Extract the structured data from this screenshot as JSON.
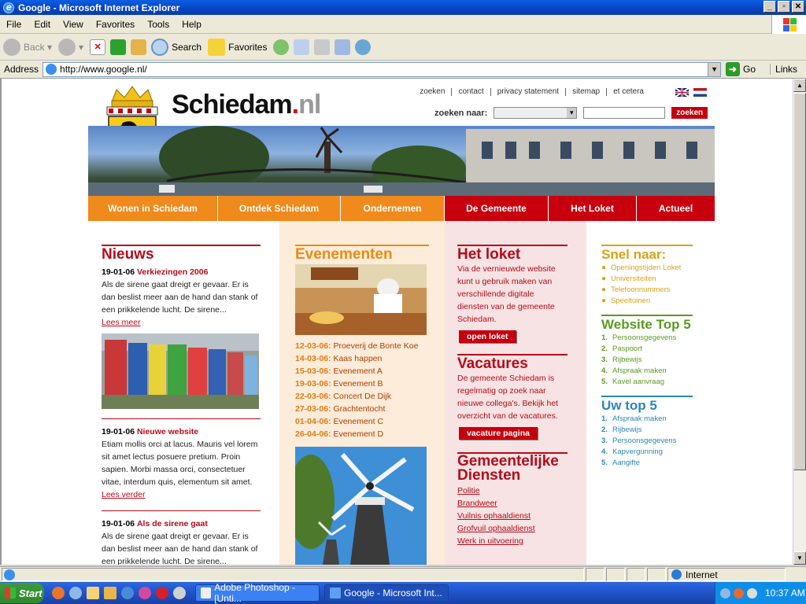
{
  "window": {
    "title": "Google - Microsoft Internet Explorer"
  },
  "menu": [
    "File",
    "Edit",
    "View",
    "Favorites",
    "Tools",
    "Help"
  ],
  "toolbar": {
    "back": "Back",
    "search": "Search",
    "favorites": "Favorites"
  },
  "address": {
    "label": "Address",
    "url": "http://www.google.nl/",
    "go": "Go",
    "links": "Links"
  },
  "site": {
    "brand": {
      "name": "Schiedam",
      "dot": ".",
      "tld": "nl"
    },
    "toplinks": [
      "zoeken",
      "contact",
      "privacy statement",
      "sitemap",
      "et cetera"
    ],
    "search": {
      "label": "zoeken naar:",
      "button": "zoeken"
    },
    "nav": [
      {
        "label": "Wonen in Schiedam",
        "color": "#f08a1c"
      },
      {
        "label": "Ontdek Schiedam",
        "color": "#f08a1c"
      },
      {
        "label": "Ondernemen",
        "color": "#f08a1c"
      },
      {
        "label": "De Gemeente",
        "color": "#c8000e"
      },
      {
        "label": "Het Loket",
        "color": "#c8000e"
      },
      {
        "label": "Actueel",
        "color": "#c8000e"
      }
    ],
    "news": {
      "title": "Nieuws",
      "items": [
        {
          "date": "19-01-06",
          "headline": "Verkiezingen 2006",
          "text": "Als de sirene gaat dreigt er gevaar. Er is dan beslist meer aan de hand dan stank of een prikkelende lucht. De sirene...",
          "more": "Lees meer"
        },
        {
          "date": "19-01-06",
          "headline": "Nieuwe website",
          "text": "Etiam mollis orci at lacus. Mauris vel lorem sit amet lectus posuere pretium. Proin sapien. Morbi massa orci, consectetuer vitae, interdum quis, elementum sit amet.",
          "more": "Lees verder"
        },
        {
          "date": "19-01-06",
          "headline": "Als de sirene gaat",
          "text": "Als de sirene gaat dreigt er gevaar. Er is dan beslist meer aan de hand dan stank of een prikkelende lucht. De sirene..."
        }
      ]
    },
    "events": {
      "title": "Evenementen",
      "items": [
        {
          "date": "12-03-06:",
          "name": "Proeverij de Bonte Koe"
        },
        {
          "date": "14-03-06:",
          "name": "Kaas happen"
        },
        {
          "date": "15-03-06:",
          "name": "Evenement A"
        },
        {
          "date": "19-03-06:",
          "name": "Evenement B"
        },
        {
          "date": "22-03-06:",
          "name": "Concert De Dijk"
        },
        {
          "date": "27-03-06:",
          "name": "Grachtentocht"
        },
        {
          "date": "01-04-06:",
          "name": "Evenement C"
        },
        {
          "date": "26-04-06:",
          "name": "Evenement D"
        }
      ]
    },
    "loket": {
      "title": "Het loket",
      "text": "Via de vernieuwde website kunt u gebruik maken van verschillende digitale diensten van de gemeente Schiedam.",
      "button": "open loket"
    },
    "vacatures": {
      "title": "Vacatures",
      "text": "De gemeente Schiedam is regelmatig op zoek naar nieuwe collega's. Bekijk het overzicht van de vacatures.",
      "button": "vacature pagina"
    },
    "diensten": {
      "title1": "Gemeentelijke",
      "title2": "Diensten",
      "links": [
        "Politie",
        "Brandweer",
        "Vuilnis ophaaldienst",
        "Grofvuil ophaaldienst",
        "Werk in uitvoering"
      ]
    },
    "snel": {
      "title": "Snel naar:",
      "items": [
        "Openingstijden Loket",
        "Universiteiten",
        "Telefoonnummers",
        "Speeltuinen"
      ]
    },
    "top5": {
      "title": "Website Top 5",
      "items": [
        "Persoonsgegevens",
        "Paspoort",
        "Rijbewijs",
        "Afspraak maken",
        "Kavel aanvraag"
      ]
    },
    "uwtop5": {
      "title": "Uw top 5",
      "items": [
        "Afspraak maken",
        "Rijbewijs",
        "Persoonsgegevens",
        "Kapvergunning",
        "Aangifte"
      ]
    }
  },
  "status": {
    "zone": "Internet"
  },
  "taskbar": {
    "start": "Start",
    "tasks": [
      "Adobe Photoshop - [Unti...",
      "Google - Microsoft Int..."
    ],
    "clock": "10:37 AM"
  }
}
